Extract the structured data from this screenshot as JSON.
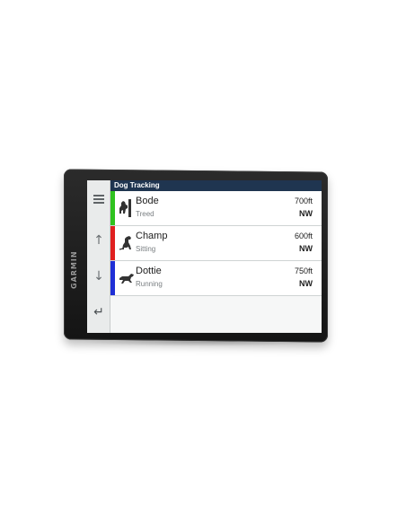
{
  "device": {
    "brand": "GARMIN"
  },
  "screen": {
    "title": "Dog Tracking"
  },
  "side": {
    "menu_icon": "menu-icon",
    "up_icon": "arrow-up-icon",
    "down_icon": "arrow-down-icon",
    "back_icon": "back-icon",
    "up_glyph": "↑",
    "down_glyph": "↓",
    "back_glyph": "↵"
  },
  "dogs": [
    {
      "name": "Bode",
      "status": "Treed",
      "distance": "700ft",
      "direction": "NW",
      "color": "#2fc21f",
      "icon": "dog-treed-icon"
    },
    {
      "name": "Champ",
      "status": "Sitting",
      "distance": "600ft",
      "direction": "NW",
      "color": "#e02020",
      "icon": "dog-sitting-icon"
    },
    {
      "name": "Dottie",
      "status": "Running",
      "distance": "750ft",
      "direction": "NW",
      "color": "#1f2fd6",
      "icon": "dog-running-icon"
    }
  ]
}
